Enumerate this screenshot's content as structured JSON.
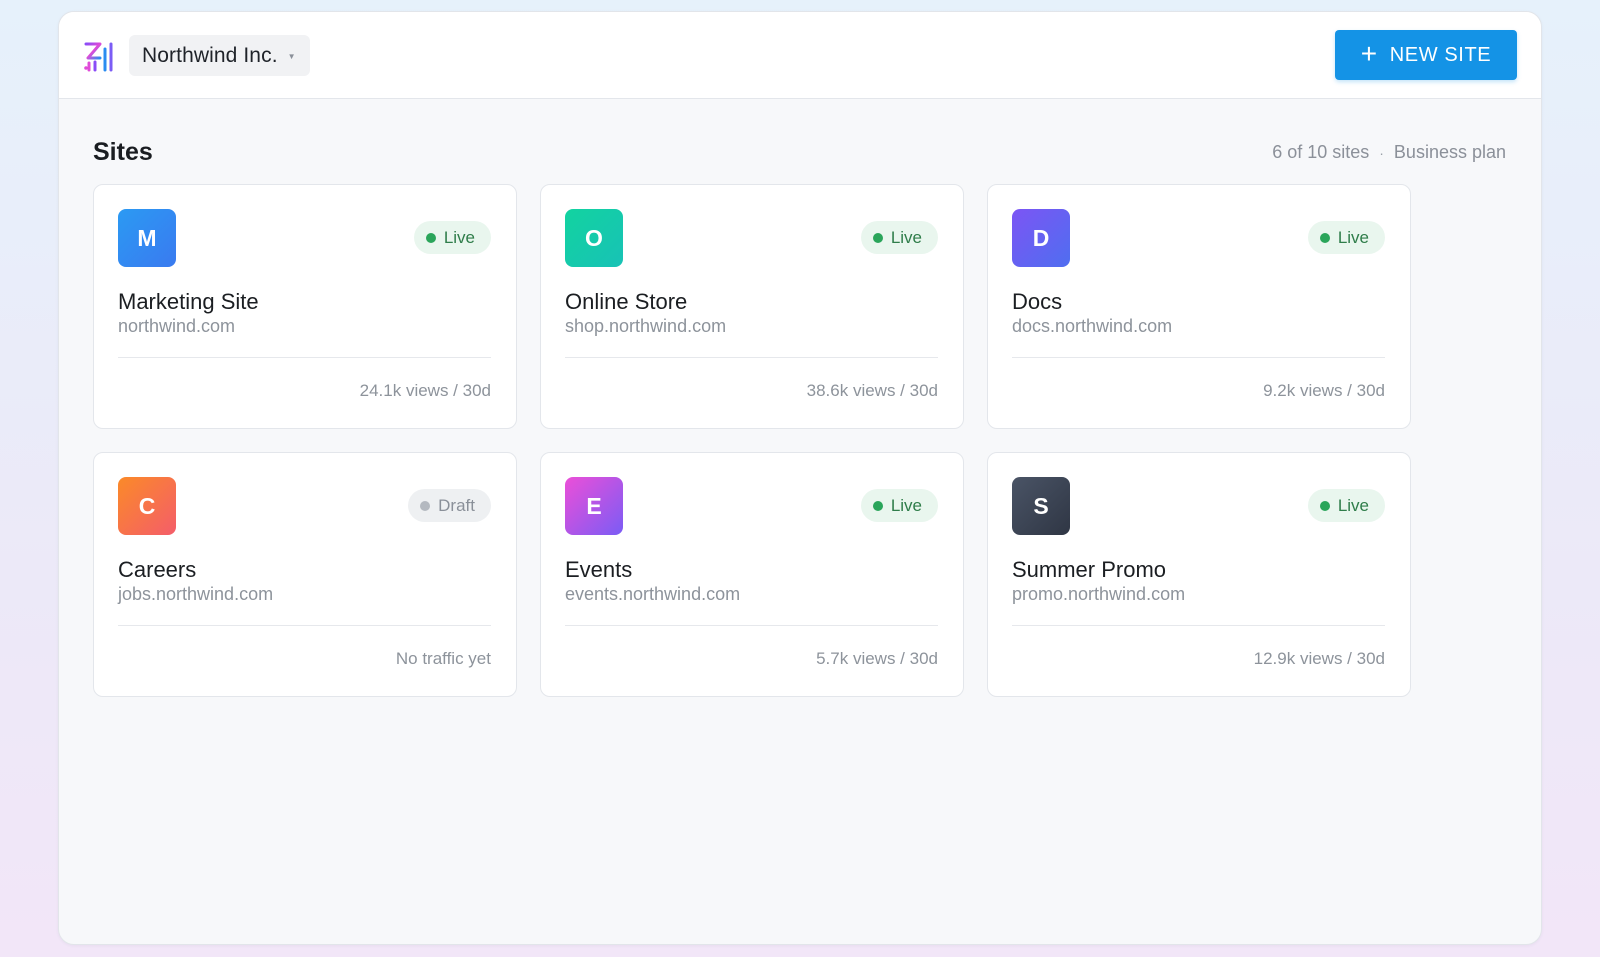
{
  "header": {
    "org_name": "Northwind Inc.",
    "new_site_label": "NEW SITE"
  },
  "main": {
    "title": "Sites",
    "usage": "6 of 10 sites",
    "plan": "Business plan"
  },
  "colors": {
    "primary": "#1493e6",
    "live_bg": "#e9f6ee",
    "live_text": "#2f7d4a",
    "live_dot": "#2aa55a",
    "draft_bg": "#eef0f2",
    "draft_text": "#8a9099",
    "draft_dot": "#b4b9c0"
  },
  "sites": [
    {
      "initial": "M",
      "name": "Marketing Site",
      "domain": "northwind.com",
      "status": "Live",
      "traffic": "24.1k views / 30d",
      "gradient": [
        "#2b9af3",
        "#3a7af0"
      ]
    },
    {
      "initial": "O",
      "name": "Online Store",
      "domain": "shop.northwind.com",
      "status": "Live",
      "traffic": "38.6k views / 30d",
      "gradient": [
        "#12d3a0",
        "#18c2b6"
      ]
    },
    {
      "initial": "D",
      "name": "Docs",
      "domain": "docs.northwind.com",
      "status": "Live",
      "traffic": "9.2k views / 30d",
      "gradient": [
        "#7c55f4",
        "#4f6ef0"
      ]
    },
    {
      "initial": "C",
      "name": "Careers",
      "domain": "jobs.northwind.com",
      "status": "Draft",
      "traffic": "No traffic yet",
      "gradient": [
        "#fb8a28",
        "#f45d6a"
      ]
    },
    {
      "initial": "E",
      "name": "Events",
      "domain": "events.northwind.com",
      "status": "Live",
      "traffic": "5.7k views / 30d",
      "gradient": [
        "#ec4fd8",
        "#7a5cf5"
      ]
    },
    {
      "initial": "S",
      "name": "Summer Promo",
      "domain": "promo.northwind.com",
      "status": "Live",
      "traffic": "12.9k views / 30d",
      "gradient": [
        "#4a5466",
        "#2f3644"
      ]
    }
  ]
}
